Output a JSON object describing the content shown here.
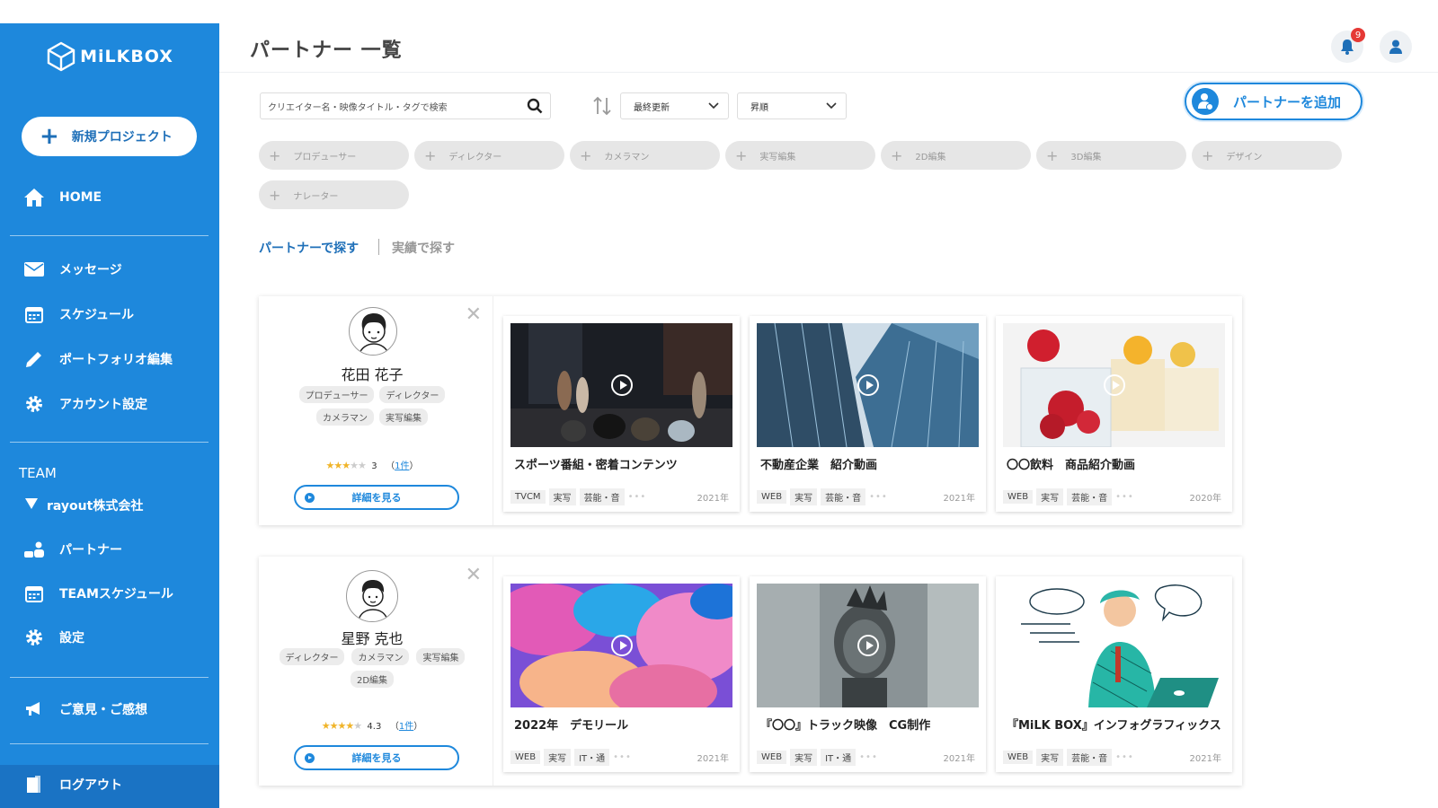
{
  "app": {
    "logo": "MiLKBOX",
    "page_title": "パートナー 一覧"
  },
  "sidebar": {
    "new_project": "新規プロジェクト",
    "home": "HOME",
    "messages": "メッセージ",
    "schedule": "スケジュール",
    "portfolio": "ポートフォリオ編集",
    "account": "アカウント設定",
    "team_label": "TEAM",
    "company": "rayout株式会社",
    "partner": "パートナー",
    "team_schedule": "TEAMスケジュール",
    "settings": "設定",
    "feedback": "ご意見・ご感想",
    "logout": "ログアウト"
  },
  "header": {
    "notification_count": "9"
  },
  "search": {
    "placeholder": "クリエイター名・映像タイトル・タグで検索"
  },
  "sort": {
    "field": "最終更新",
    "order": "昇順"
  },
  "add_partner": "パートナーを追加",
  "chips": [
    "プロデューサー",
    "ディレクター",
    "カメラマン",
    "実写編集",
    "2D編集",
    "3D編集",
    "デザイン",
    "ナレーター"
  ],
  "tabs": {
    "active": "パートナーで探す",
    "inactive": "実績で探す"
  },
  "partners": [
    {
      "name": "花田 花子",
      "tags": [
        "プロデューサー",
        "ディレクター",
        "カメラマン",
        "実写編集"
      ],
      "rating": "3",
      "stars": 3,
      "review_open": "（",
      "review_count": "1件",
      "review_close": "）",
      "detail": "詳細を見る",
      "works": [
        {
          "title": "スポーツ番組・密着コンテンツ",
          "tags": [
            "TVCM",
            "実写",
            "芸能・音"
          ],
          "year": "2021年"
        },
        {
          "title": "不動産企業　紹介動画",
          "tags": [
            "WEB",
            "実写",
            "芸能・音"
          ],
          "year": "2021年"
        },
        {
          "title": "〇〇飲料　商品紹介動画",
          "tags": [
            "WEB",
            "実写",
            "芸能・音"
          ],
          "year": "2020年"
        }
      ]
    },
    {
      "name": "星野 克也",
      "tags": [
        "ディレクター",
        "カメラマン",
        "実写編集",
        "2D編集"
      ],
      "rating": "4.3",
      "stars": 4,
      "review_open": "（",
      "review_count": "1件",
      "review_close": "）",
      "detail": "詳細を見る",
      "works": [
        {
          "title": "2022年　デモリール",
          "tags": [
            "WEB",
            "実写",
            "IT・通"
          ],
          "year": "2021年"
        },
        {
          "title": "『〇〇』トラック映像　CG制作",
          "tags": [
            "WEB",
            "実写",
            "IT・通"
          ],
          "year": "2021年"
        },
        {
          "title": "『MiLK BOX』インフォグラフィックス",
          "tags": [
            "WEB",
            "実写",
            "芸能・音"
          ],
          "year": "2021年"
        }
      ]
    }
  ]
}
